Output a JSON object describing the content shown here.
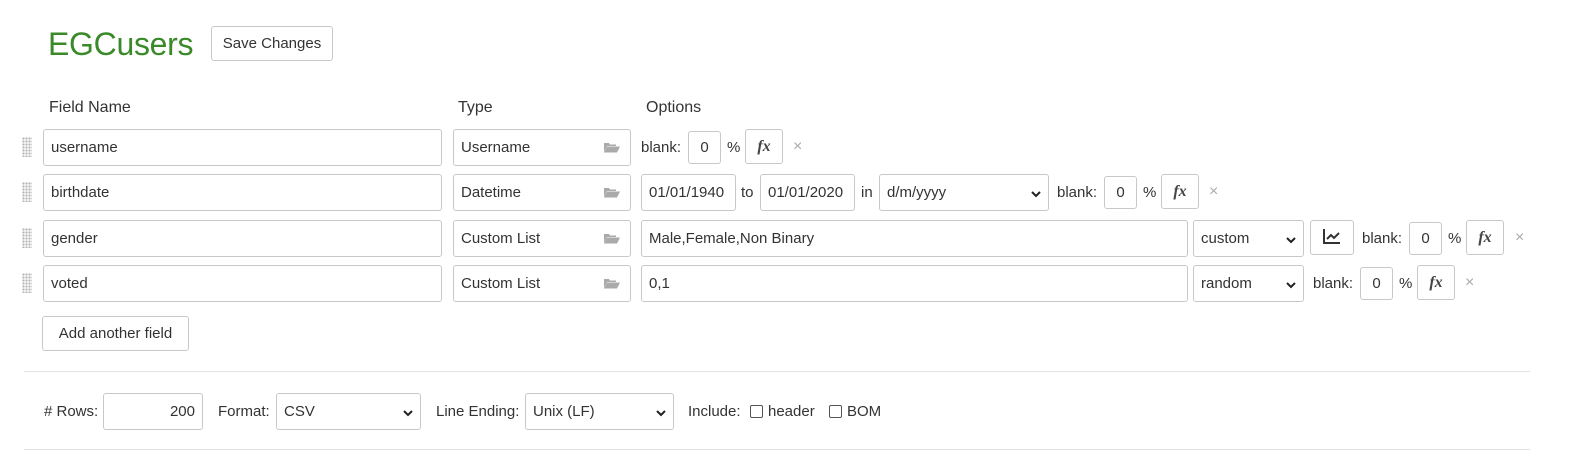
{
  "title": "EGCusers",
  "save_label": "Save Changes",
  "headers": {
    "field_name": "Field Name",
    "type": "Type",
    "options": "Options"
  },
  "fields": [
    {
      "name": "username",
      "type": "Username",
      "blank_label": "blank:",
      "blank_value": "0",
      "pct": "%",
      "fx": "fx",
      "remove": "×"
    },
    {
      "name": "birthdate",
      "type": "Datetime",
      "from": "01/01/1940",
      "to_label": "to",
      "to": "01/01/2020",
      "in_label": "in",
      "format": "d/m/yyyy",
      "blank_label": "blank:",
      "blank_value": "0",
      "pct": "%",
      "fx": "fx",
      "remove": "×"
    },
    {
      "name": "gender",
      "type": "Custom List",
      "values": "Male,Female,Non Binary",
      "mode": "custom",
      "blank_label": "blank:",
      "blank_value": "0",
      "pct": "%",
      "fx": "fx",
      "remove": "×"
    },
    {
      "name": "voted",
      "type": "Custom List",
      "values": "0,1",
      "mode": "random",
      "blank_label": "blank:",
      "blank_value": "0",
      "pct": "%",
      "fx": "fx",
      "remove": "×"
    }
  ],
  "add_label": "Add another field",
  "settings": {
    "rows_label": "# Rows:",
    "rows_value": "200",
    "format_label": "Format:",
    "format_value": "CSV",
    "line_ending_label": "Line Ending:",
    "line_ending_value": "Unix (LF)",
    "include_label": "Include:",
    "header_label": "header",
    "bom_label": "BOM"
  },
  "colors": {
    "title": "#3a8a2a",
    "border": "#c8c8c8"
  }
}
